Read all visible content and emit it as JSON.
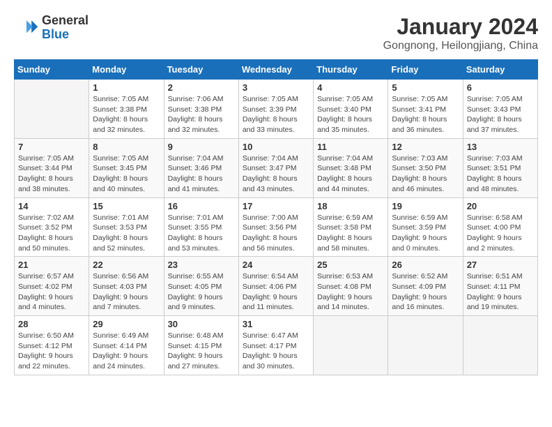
{
  "logo": {
    "line1": "General",
    "line2": "Blue"
  },
  "title": "January 2024",
  "subtitle": "Gongnong, Heilongjiang, China",
  "days_header": [
    "Sunday",
    "Monday",
    "Tuesday",
    "Wednesday",
    "Thursday",
    "Friday",
    "Saturday"
  ],
  "weeks": [
    [
      {
        "num": "",
        "info": ""
      },
      {
        "num": "1",
        "info": "Sunrise: 7:05 AM\nSunset: 3:38 PM\nDaylight: 8 hours\nand 32 minutes."
      },
      {
        "num": "2",
        "info": "Sunrise: 7:06 AM\nSunset: 3:38 PM\nDaylight: 8 hours\nand 32 minutes."
      },
      {
        "num": "3",
        "info": "Sunrise: 7:05 AM\nSunset: 3:39 PM\nDaylight: 8 hours\nand 33 minutes."
      },
      {
        "num": "4",
        "info": "Sunrise: 7:05 AM\nSunset: 3:40 PM\nDaylight: 8 hours\nand 35 minutes."
      },
      {
        "num": "5",
        "info": "Sunrise: 7:05 AM\nSunset: 3:41 PM\nDaylight: 8 hours\nand 36 minutes."
      },
      {
        "num": "6",
        "info": "Sunrise: 7:05 AM\nSunset: 3:43 PM\nDaylight: 8 hours\nand 37 minutes."
      }
    ],
    [
      {
        "num": "7",
        "info": "Sunrise: 7:05 AM\nSunset: 3:44 PM\nDaylight: 8 hours\nand 38 minutes."
      },
      {
        "num": "8",
        "info": "Sunrise: 7:05 AM\nSunset: 3:45 PM\nDaylight: 8 hours\nand 40 minutes."
      },
      {
        "num": "9",
        "info": "Sunrise: 7:04 AM\nSunset: 3:46 PM\nDaylight: 8 hours\nand 41 minutes."
      },
      {
        "num": "10",
        "info": "Sunrise: 7:04 AM\nSunset: 3:47 PM\nDaylight: 8 hours\nand 43 minutes."
      },
      {
        "num": "11",
        "info": "Sunrise: 7:04 AM\nSunset: 3:48 PM\nDaylight: 8 hours\nand 44 minutes."
      },
      {
        "num": "12",
        "info": "Sunrise: 7:03 AM\nSunset: 3:50 PM\nDaylight: 8 hours\nand 46 minutes."
      },
      {
        "num": "13",
        "info": "Sunrise: 7:03 AM\nSunset: 3:51 PM\nDaylight: 8 hours\nand 48 minutes."
      }
    ],
    [
      {
        "num": "14",
        "info": "Sunrise: 7:02 AM\nSunset: 3:52 PM\nDaylight: 8 hours\nand 50 minutes."
      },
      {
        "num": "15",
        "info": "Sunrise: 7:01 AM\nSunset: 3:53 PM\nDaylight: 8 hours\nand 52 minutes."
      },
      {
        "num": "16",
        "info": "Sunrise: 7:01 AM\nSunset: 3:55 PM\nDaylight: 8 hours\nand 53 minutes."
      },
      {
        "num": "17",
        "info": "Sunrise: 7:00 AM\nSunset: 3:56 PM\nDaylight: 8 hours\nand 56 minutes."
      },
      {
        "num": "18",
        "info": "Sunrise: 6:59 AM\nSunset: 3:58 PM\nDaylight: 8 hours\nand 58 minutes."
      },
      {
        "num": "19",
        "info": "Sunrise: 6:59 AM\nSunset: 3:59 PM\nDaylight: 9 hours\nand 0 minutes."
      },
      {
        "num": "20",
        "info": "Sunrise: 6:58 AM\nSunset: 4:00 PM\nDaylight: 9 hours\nand 2 minutes."
      }
    ],
    [
      {
        "num": "21",
        "info": "Sunrise: 6:57 AM\nSunset: 4:02 PM\nDaylight: 9 hours\nand 4 minutes."
      },
      {
        "num": "22",
        "info": "Sunrise: 6:56 AM\nSunset: 4:03 PM\nDaylight: 9 hours\nand 7 minutes."
      },
      {
        "num": "23",
        "info": "Sunrise: 6:55 AM\nSunset: 4:05 PM\nDaylight: 9 hours\nand 9 minutes."
      },
      {
        "num": "24",
        "info": "Sunrise: 6:54 AM\nSunset: 4:06 PM\nDaylight: 9 hours\nand 11 minutes."
      },
      {
        "num": "25",
        "info": "Sunrise: 6:53 AM\nSunset: 4:08 PM\nDaylight: 9 hours\nand 14 minutes."
      },
      {
        "num": "26",
        "info": "Sunrise: 6:52 AM\nSunset: 4:09 PM\nDaylight: 9 hours\nand 16 minutes."
      },
      {
        "num": "27",
        "info": "Sunrise: 6:51 AM\nSunset: 4:11 PM\nDaylight: 9 hours\nand 19 minutes."
      }
    ],
    [
      {
        "num": "28",
        "info": "Sunrise: 6:50 AM\nSunset: 4:12 PM\nDaylight: 9 hours\nand 22 minutes."
      },
      {
        "num": "29",
        "info": "Sunrise: 6:49 AM\nSunset: 4:14 PM\nDaylight: 9 hours\nand 24 minutes."
      },
      {
        "num": "30",
        "info": "Sunrise: 6:48 AM\nSunset: 4:15 PM\nDaylight: 9 hours\nand 27 minutes."
      },
      {
        "num": "31",
        "info": "Sunrise: 6:47 AM\nSunset: 4:17 PM\nDaylight: 9 hours\nand 30 minutes."
      },
      {
        "num": "",
        "info": ""
      },
      {
        "num": "",
        "info": ""
      },
      {
        "num": "",
        "info": ""
      }
    ]
  ]
}
